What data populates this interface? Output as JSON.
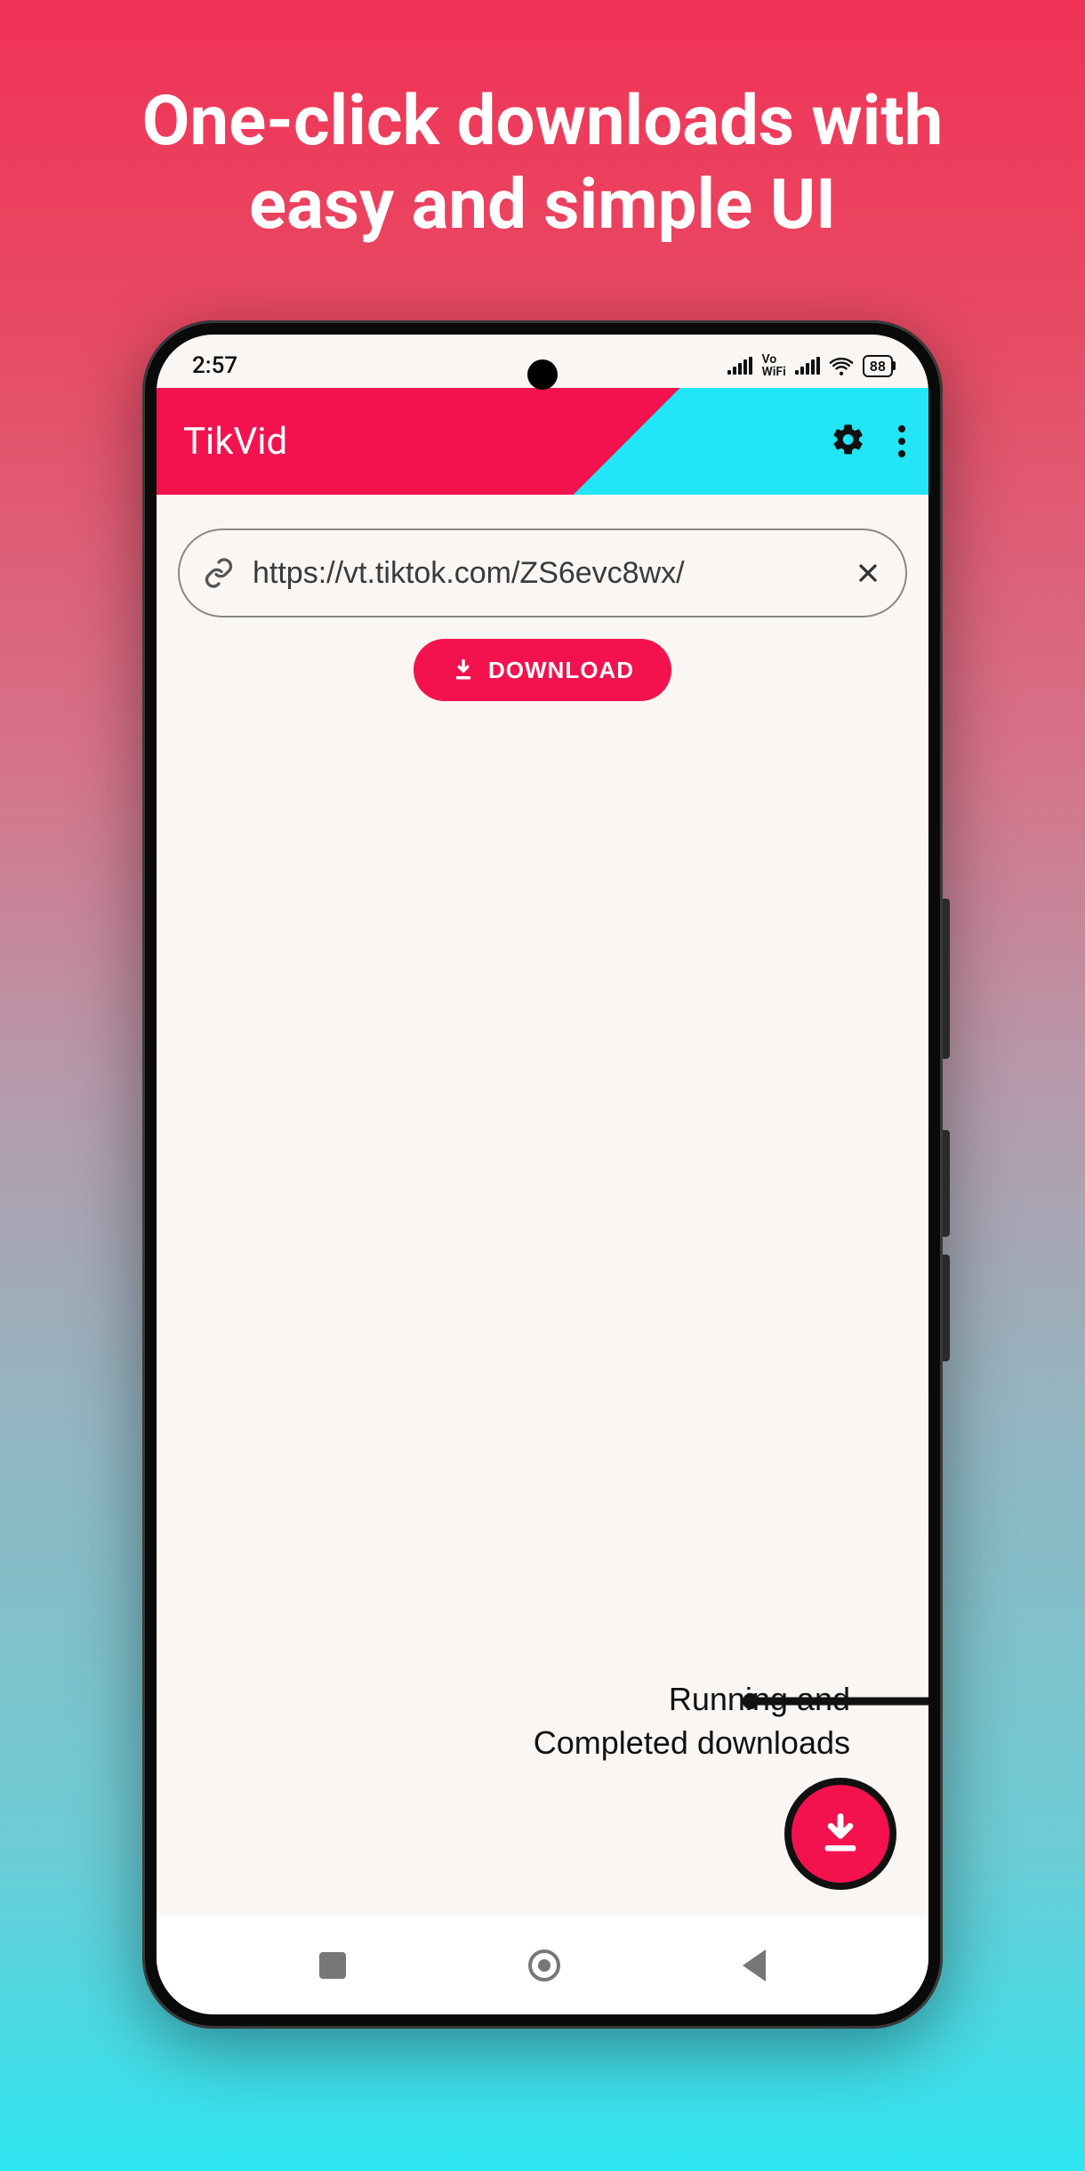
{
  "promo": {
    "headline_line1": "One-click downloads with",
    "headline_line2": "easy and simple UI"
  },
  "statusbar": {
    "time": "2:57",
    "vo_label": "Vo",
    "wifi_text_label": "WiFi",
    "battery": "88"
  },
  "app": {
    "title": "TikVid"
  },
  "input": {
    "url_value": "https://vt.tiktok.com/ZS6evc8wx/"
  },
  "buttons": {
    "download": "DOWNLOAD"
  },
  "callout": {
    "line1": "Running and",
    "line2": "Completed downloads"
  }
}
